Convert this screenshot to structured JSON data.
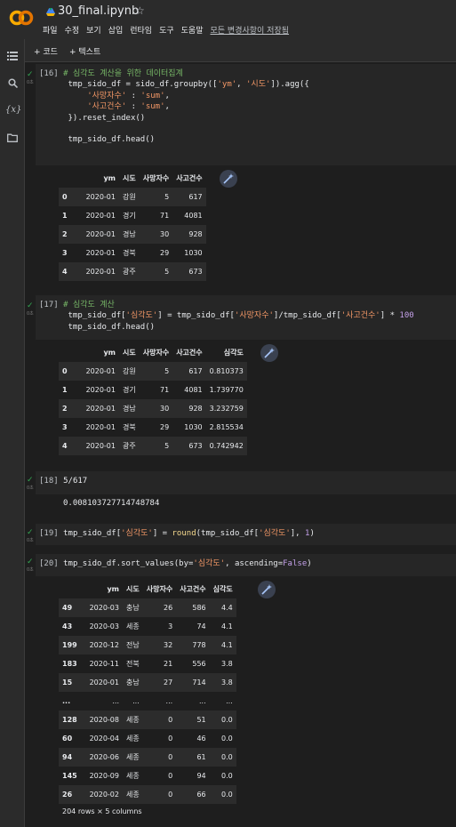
{
  "header": {
    "title": "30_final.ipynb",
    "menu": [
      "파일",
      "수정",
      "보기",
      "삽입",
      "런타임",
      "도구",
      "도움말"
    ],
    "saved_status": "모든 변경사항이 저장됨"
  },
  "toolbar": {
    "add_code": "+ 코드",
    "add_text": "+ 텍스트"
  },
  "sidebar": {
    "icons": [
      "table-of-contents-icon",
      "search-icon",
      "variables-icon",
      "folder-icon"
    ]
  },
  "cells": {
    "c16": {
      "count": "[16]",
      "line1_comment": "# 심각도 계산을 위한 데이터집계",
      "line2": "tmp_sido_df = sido_df.groupby(['ym', '시도']).agg({",
      "line3": "    '사망자수' : 'sum',",
      "line4": "    '사고건수' : 'sum',",
      "line5": "}).reset_index()",
      "line6": "tmp_sido_df.head()",
      "table": {
        "columns": [
          "ym",
          "시도",
          "사망자수",
          "사고건수"
        ],
        "rows": [
          {
            "idx": "0",
            "ym": "2020-01",
            "sido": "강원",
            "deaths": "5",
            "accidents": "617"
          },
          {
            "idx": "1",
            "ym": "2020-01",
            "sido": "경기",
            "deaths": "71",
            "accidents": "4081"
          },
          {
            "idx": "2",
            "ym": "2020-01",
            "sido": "경남",
            "deaths": "30",
            "accidents": "928"
          },
          {
            "idx": "3",
            "ym": "2020-01",
            "sido": "경북",
            "deaths": "29",
            "accidents": "1030"
          },
          {
            "idx": "4",
            "ym": "2020-01",
            "sido": "광주",
            "deaths": "5",
            "accidents": "673"
          }
        ]
      }
    },
    "c17": {
      "count": "[17]",
      "line1_comment": "# 심각도 계산",
      "line2": "tmp_sido_df['심각도'] = tmp_sido_df['사망자수']/tmp_sido_df['사고건수'] * 100",
      "line3": "tmp_sido_df.head()",
      "table": {
        "columns": [
          "ym",
          "시도",
          "사망자수",
          "사고건수",
          "심각도"
        ],
        "rows": [
          {
            "idx": "0",
            "ym": "2020-01",
            "sido": "강원",
            "deaths": "5",
            "accidents": "617",
            "sev": "0.810373"
          },
          {
            "idx": "1",
            "ym": "2020-01",
            "sido": "경기",
            "deaths": "71",
            "accidents": "4081",
            "sev": "1.739770"
          },
          {
            "idx": "2",
            "ym": "2020-01",
            "sido": "경남",
            "deaths": "30",
            "accidents": "928",
            "sev": "3.232759"
          },
          {
            "idx": "3",
            "ym": "2020-01",
            "sido": "경북",
            "deaths": "29",
            "accidents": "1030",
            "sev": "2.815534"
          },
          {
            "idx": "4",
            "ym": "2020-01",
            "sido": "광주",
            "deaths": "5",
            "accidents": "673",
            "sev": "0.742942"
          }
        ]
      }
    },
    "c18": {
      "count": "[18]",
      "code": "5/617",
      "output": "0.008103727714748784"
    },
    "c19": {
      "count": "[19]",
      "code": "tmp_sido_df['심각도'] = round(tmp_sido_df['심각도'], 1)"
    },
    "c20": {
      "count": "[20]",
      "code": "tmp_sido_df.sort_values(by='심각도', ascending=False)",
      "table": {
        "columns": [
          "ym",
          "시도",
          "사망자수",
          "사고건수",
          "심각도"
        ],
        "rows": [
          {
            "idx": "49",
            "ym": "2020-03",
            "sido": "충남",
            "deaths": "26",
            "accidents": "586",
            "sev": "4.4"
          },
          {
            "idx": "43",
            "ym": "2020-03",
            "sido": "세종",
            "deaths": "3",
            "accidents": "74",
            "sev": "4.1"
          },
          {
            "idx": "199",
            "ym": "2020-12",
            "sido": "전남",
            "deaths": "32",
            "accidents": "778",
            "sev": "4.1"
          },
          {
            "idx": "183",
            "ym": "2020-11",
            "sido": "전북",
            "deaths": "21",
            "accidents": "556",
            "sev": "3.8"
          },
          {
            "idx": "15",
            "ym": "2020-01",
            "sido": "충남",
            "deaths": "27",
            "accidents": "714",
            "sev": "3.8"
          },
          {
            "idx": "...",
            "ym": "...",
            "sido": "...",
            "deaths": "...",
            "accidents": "...",
            "sev": "..."
          },
          {
            "idx": "128",
            "ym": "2020-08",
            "sido": "세종",
            "deaths": "0",
            "accidents": "51",
            "sev": "0.0"
          },
          {
            "idx": "60",
            "ym": "2020-04",
            "sido": "세종",
            "deaths": "0",
            "accidents": "46",
            "sev": "0.0"
          },
          {
            "idx": "94",
            "ym": "2020-06",
            "sido": "세종",
            "deaths": "0",
            "accidents": "61",
            "sev": "0.0"
          },
          {
            "idx": "145",
            "ym": "2020-09",
            "sido": "세종",
            "deaths": "0",
            "accidents": "94",
            "sev": "0.0"
          },
          {
            "idx": "26",
            "ym": "2020-02",
            "sido": "세종",
            "deaths": "0",
            "accidents": "66",
            "sev": "0.0"
          }
        ]
      },
      "shape": "204 rows × 5 columns"
    },
    "check_mark": "✓",
    "sec_label": "0초"
  },
  "colors": {
    "accent_green": "#34a853",
    "comment": "#77b767",
    "string": "#f29766",
    "logo_orange": "#f9ab00"
  }
}
